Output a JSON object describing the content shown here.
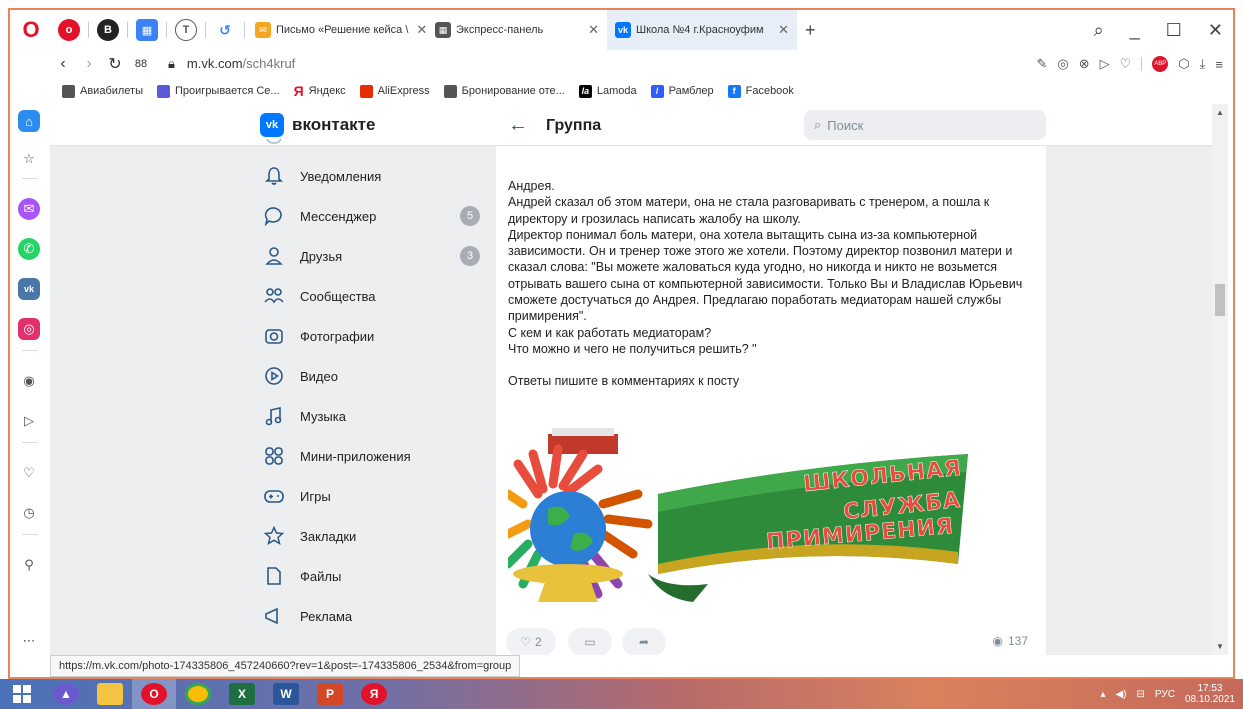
{
  "browser": {
    "tabs": [
      {
        "label": "Письмо «Решение кейса \\",
        "favicon": "mail-icon",
        "color": "#f5a623"
      },
      {
        "label": "Экспресс-панель",
        "favicon": "grid-icon",
        "color": "#555555"
      },
      {
        "label": "Школа №4 г.Красноуфим",
        "favicon": "vk-icon",
        "color": "#0077ff",
        "active": true
      }
    ],
    "url_domain": "m.vk.com",
    "url_path": "/sch4kruf",
    "bookmarks": [
      {
        "label": "Авиабилеты",
        "color": "#555555"
      },
      {
        "label": "Проигрывается Се...",
        "color": "#5b5bd6"
      },
      {
        "label": "Яндекс",
        "color": "#e1122a",
        "glyph": "Я"
      },
      {
        "label": "AliExpress",
        "color": "#e62e04"
      },
      {
        "label": "Бронирование оте...",
        "color": "#555555"
      },
      {
        "label": "Lamoda",
        "color": "#000000",
        "glyph": "la"
      },
      {
        "label": "Рамблер",
        "color": "#315efb"
      },
      {
        "label": "Facebook",
        "color": "#1877f2",
        "glyph": "f"
      }
    ],
    "status_url": "https://m.vk.com/photo-174335806_457240660?rev=1&post=-174335806_2534&from=group"
  },
  "vk": {
    "logo_text": "вконтакте",
    "logo_badge": "vk",
    "header_title": "Группа",
    "search_placeholder": "Поиск",
    "menu": [
      {
        "label": "Уведомления",
        "icon": "bell-icon"
      },
      {
        "label": "Мессенджер",
        "icon": "message-icon",
        "badge": "5"
      },
      {
        "label": "Друзья",
        "icon": "friends-icon",
        "badge": "3"
      },
      {
        "label": "Сообщества",
        "icon": "communities-icon"
      },
      {
        "label": "Фотографии",
        "icon": "camera-icon"
      },
      {
        "label": "Видео",
        "icon": "video-icon"
      },
      {
        "label": "Музыка",
        "icon": "music-icon"
      },
      {
        "label": "Мини-приложения",
        "icon": "apps-icon"
      },
      {
        "label": "Игры",
        "icon": "gamepad-icon"
      },
      {
        "label": "Закладки",
        "icon": "star-icon"
      },
      {
        "label": "Файлы",
        "icon": "file-icon"
      },
      {
        "label": "Реклама",
        "icon": "ads-icon"
      }
    ],
    "post": {
      "lines": [
        "Андрея.",
        "Андрей сказал об этом матери, она не стала разговаривать с тренером, а пошла к директору и грозилась написать жалобу на школу.",
        "Директор понимал боль матери, она хотела вытащить сына из-за компьютерной зависимости. Он и тренер тоже этого же хотели. Поэтому директор позвонил матери и сказал слова: \"Вы можете жаловаться куда угодно, но никогда и никто не возьмется отрывать вашего сына от компьютерной зависимости. Только Вы и Владислав Юрьевич сможете достучаться до Андрея. Предлагаю поработать медиаторам нашей службы примирения\".",
        "С кем и как работать медиаторам?",
        "Что можно и чего не получиться решить? \"",
        "",
        "Ответы пишите в комментариях к посту"
      ],
      "image_text": [
        "ШКОЛЬНАЯ",
        "СЛУЖБА",
        "ПРИМИРЕНИЯ"
      ],
      "likes": "2",
      "views": "137"
    }
  },
  "taskbar": {
    "lang": "РУС",
    "time": "17:53",
    "date": "08.10.2021"
  }
}
